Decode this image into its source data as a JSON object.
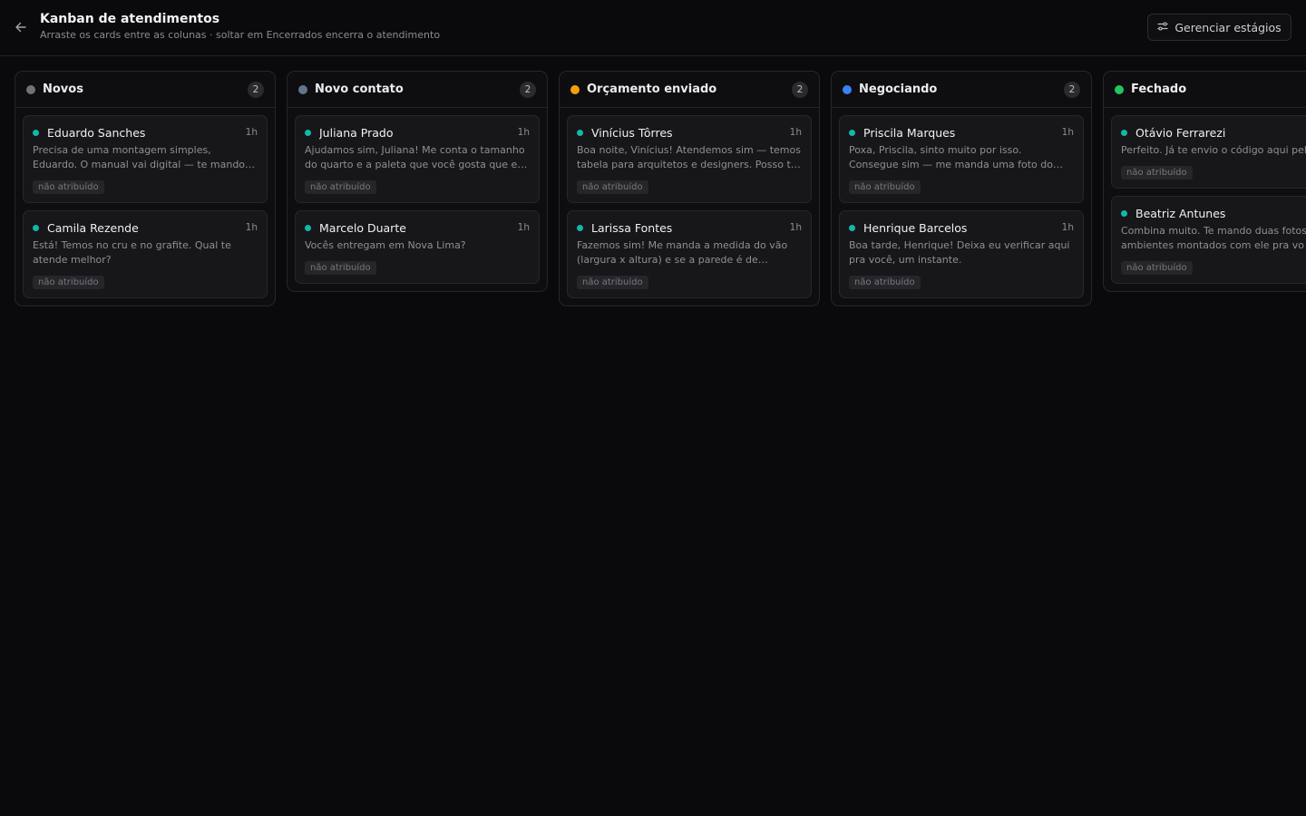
{
  "header": {
    "title": "Kanban de atendimentos",
    "subtitle": "Arraste os cards entre as colunas · soltar em Encerrados encerra o atendimento",
    "manage_label": "Gerenciar estágios"
  },
  "colors": {
    "background": "#0a0a0c",
    "card_status": "#14b8a6",
    "novos": "#71717a",
    "novo_contato": "#64748b",
    "orcamento": "#f59e0b",
    "negociando": "#3b82f6",
    "fechado": "#22c55e"
  },
  "columns": [
    {
      "title": "Novos",
      "count": "2",
      "cards": [
        {
          "name": "Eduardo Sanches",
          "time": "1h",
          "message": "Precisa de uma montagem simples, Eduardo. O manual vai digital — te mando…",
          "tag": "não atribuído"
        },
        {
          "name": "Camila Rezende",
          "time": "1h",
          "message": "Está! Temos no cru e no grafite. Qual te atende melhor?",
          "tag": "não atribuído"
        }
      ]
    },
    {
      "title": "Novo contato",
      "count": "2",
      "cards": [
        {
          "name": "Juliana Prado",
          "time": "1h",
          "message": "Ajudamos sim, Juliana! Me conta o tamanho do quarto e a paleta que você gosta que e…",
          "tag": "não atribuído"
        },
        {
          "name": "Marcelo Duarte",
          "time": "1h",
          "message": "Vocês entregam em Nova Lima?",
          "tag": "não atribuído"
        }
      ]
    },
    {
      "title": "Orçamento enviado",
      "count": "2",
      "cards": [
        {
          "name": "Vinícius Tôrres",
          "time": "1h",
          "message": "Boa noite, Vinícius! Atendemos sim — temos tabela para arquitetos e designers. Posso t…",
          "tag": "não atribuído"
        },
        {
          "name": "Larissa Fontes",
          "time": "1h",
          "message": "Fazemos sim! Me manda a medida do vão (largura x altura) e se a parede é de…",
          "tag": "não atribuído"
        }
      ]
    },
    {
      "title": "Negociando",
      "count": "2",
      "cards": [
        {
          "name": "Priscila Marques",
          "time": "1h",
          "message": "Poxa, Priscila, sinto muito por isso. Consegue sim — me manda uma foto do…",
          "tag": "não atribuído"
        },
        {
          "name": "Henrique Barcelos",
          "time": "1h",
          "message": "Boa tarde, Henrique! Deixa eu verificar aqui pra você, um instante.",
          "tag": "não atribuído"
        }
      ]
    },
    {
      "title": "Fechado",
      "count": "",
      "cards": [
        {
          "name": "Otávio Ferrarezi",
          "time": "",
          "message": "Perfeito. Já te envio o código aqui pel",
          "tag": "não atribuído"
        },
        {
          "name": "Beatriz Antunes",
          "time": "",
          "message": "Combina muito. Te mando duas fotos ambientes montados com ele pra vo",
          "tag": "não atribuído"
        }
      ]
    }
  ]
}
